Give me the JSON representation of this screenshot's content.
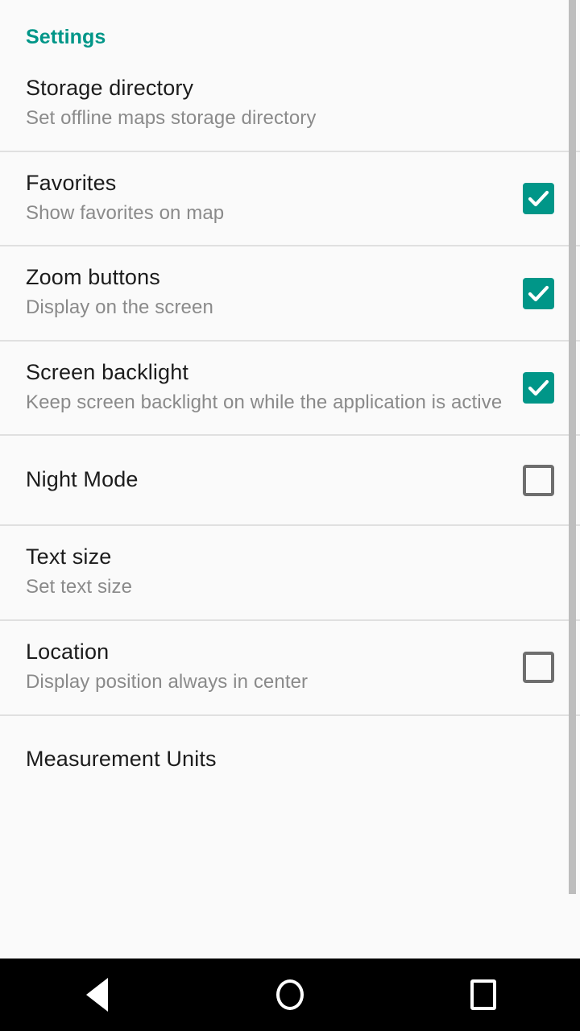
{
  "screen": {
    "app_section_title": "Settings",
    "background_color": "#fafafa",
    "accent_color": "#009688",
    "divider_color": "#e0e0e0",
    "title_color": "#1c1c1c",
    "summary_color": "#8a8a8a"
  },
  "preferences": [
    {
      "title": "Storage directory",
      "summary": "Set offline maps storage directory",
      "widget": "none",
      "checked": null
    },
    {
      "title": "Favorites",
      "summary": "Show favorites on map",
      "widget": "checkbox",
      "checked": true
    },
    {
      "title": "Zoom buttons",
      "summary": "Display on the screen",
      "widget": "checkbox",
      "checked": true
    },
    {
      "title": "Screen backlight",
      "summary": "Keep screen backlight on while the application is active",
      "widget": "checkbox",
      "checked": true
    },
    {
      "title": "Night Mode",
      "summary": "",
      "widget": "checkbox",
      "checked": false
    },
    {
      "title": "Text size",
      "summary": "Set text size",
      "widget": "none",
      "checked": null
    },
    {
      "title": "Location",
      "summary": "Display position always in center",
      "widget": "checkbox",
      "checked": false
    },
    {
      "title": "Measurement Units",
      "summary": "",
      "widget": "none",
      "checked": null
    }
  ],
  "scrollbar": {
    "visible": true,
    "color": "#bdbdbd"
  },
  "navbar": {
    "background_color": "#000000",
    "buttons": [
      {
        "name": "back",
        "icon": "back-triangle-icon"
      },
      {
        "name": "home",
        "icon": "home-circle-icon"
      },
      {
        "name": "recents",
        "icon": "recents-square-icon"
      }
    ]
  }
}
